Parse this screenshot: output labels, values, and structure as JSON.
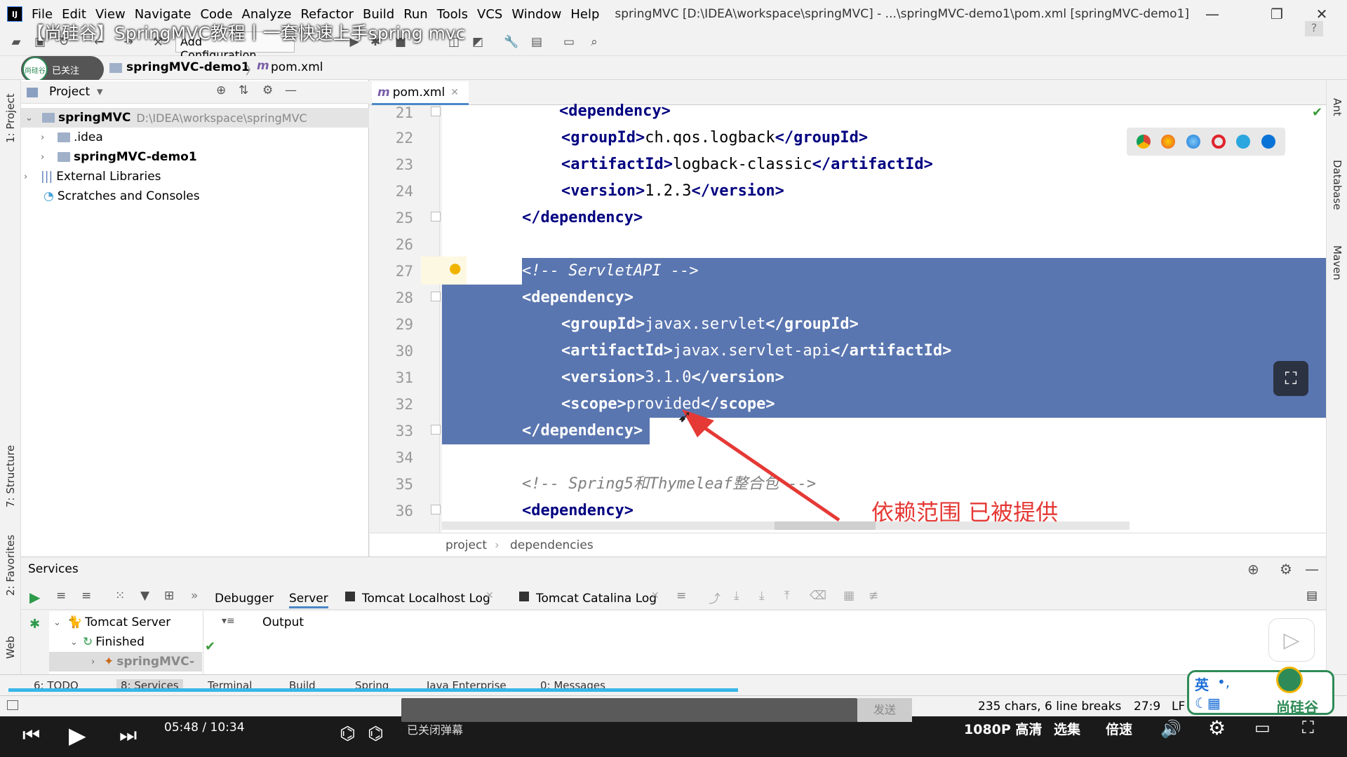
{
  "app": {
    "logo": "IJ",
    "menu": [
      "File",
      "Edit",
      "View",
      "Navigate",
      "Code",
      "Analyze",
      "Refactor",
      "Build",
      "Run",
      "Tools",
      "VCS",
      "Window",
      "Help"
    ],
    "window_title": "springMVC [D:\\IDEA\\workspace\\springMVC] - ...\\springMVC-demo1\\pom.xml [springMVC-demo1]"
  },
  "video_overlay": {
    "title": "【尚硅谷】SpringMVC教程丨一套快速上手spring mvc",
    "follow_label": "已关注",
    "follow_avatar": "尚硅谷"
  },
  "toolbar": {
    "config_label": "Add Configuration..."
  },
  "navbar": {
    "items": [
      "ng",
      "springMVC-demo1",
      "pom.xml"
    ]
  },
  "left_strip": {
    "project": "1: Project",
    "structure": "7: Structure",
    "favorites": "2: Favorites",
    "web": "Web"
  },
  "right_strip": {
    "ant": "Ant",
    "database": "Database",
    "maven": "Maven"
  },
  "project_panel": {
    "title": "Project",
    "tree": [
      {
        "name": "springMVC",
        "path": "D:\\IDEA\\workspace\\springMVC",
        "bold": true
      },
      {
        "name": ".idea"
      },
      {
        "name": "springMVC-demo1",
        "bold": true
      },
      {
        "name": "External Libraries"
      },
      {
        "name": "Scratches and Consoles"
      }
    ]
  },
  "editor": {
    "tab": "pom.xml",
    "line_numbers": [
      "21",
      "22",
      "23",
      "24",
      "25",
      "26",
      "27",
      "28",
      "29",
      "30",
      "31",
      "32",
      "33",
      "34",
      "35",
      "36"
    ],
    "lines": {
      "l21": "    <dependency>",
      "l22a": "<groupId>",
      "l22b": "ch.qos.logback",
      "l22c": "</groupId>",
      "l23a": "<artifactId>",
      "l23b": "logback-classic",
      "l23c": "</artifactId>",
      "l24a": "<version>",
      "l24b": "1.2.3",
      "l24c": "</version>",
      "l25": "</dependency>",
      "l27": "<!-- ServletAPI -->",
      "l28": "<dependency>",
      "l29a": "<groupId>",
      "l29b": "javax.servlet",
      "l29c": "</groupId>",
      "l30a": "<artifactId>",
      "l30b": "javax.servlet-api",
      "l30c": "</artifactId>",
      "l31a": "<version>",
      "l31b": "3.1.0",
      "l31c": "</version>",
      "l32a": "<scope>",
      "l32b": "provided",
      "l32c": "</scope>",
      "l33": "</dependency>",
      "l35": "<!-- Spring5和Thymeleaf整合包 -->",
      "l36": "<dependency>"
    },
    "breadcrumb": [
      "project",
      "dependencies"
    ],
    "annotation": "依赖范围 已被提供"
  },
  "services": {
    "title": "Services",
    "tabs": [
      "Debugger",
      "Server",
      "Tomcat Localhost Log",
      "Tomcat Catalina Log"
    ],
    "output_label": "Output",
    "tree": [
      "Tomcat Server",
      "Finished",
      "springMVC-"
    ]
  },
  "bottom_tabs": [
    "6: TODO",
    "8: Services",
    "Terminal",
    "Build",
    "Spring",
    "Java Enterprise",
    "0: Messages"
  ],
  "status": {
    "chars": "235 chars, 6 line breaks",
    "position": "27:9",
    "line_sep": "LF"
  },
  "player": {
    "time": "05:48 / 10:34",
    "danmaku": "已关闭弹幕",
    "send": "发送",
    "quality": "1080P 高清",
    "select": "选集",
    "speed": "倍速"
  },
  "brand": {
    "name": "尚硅谷",
    "ime": "英"
  },
  "colors": {
    "selection": "#5a76b0",
    "tag": "#000080",
    "comment": "#808080",
    "annotation": "#e53935",
    "progress": "#38b6e8"
  }
}
